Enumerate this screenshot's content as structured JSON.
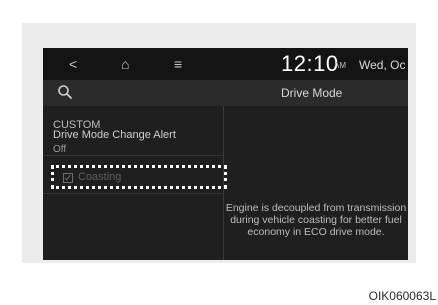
{
  "status_bar": {
    "back_icon": "<",
    "home_icon": "⌂",
    "menu_icon": "≡",
    "time": "12:10",
    "ampm": "AM",
    "date": "Wed, Oc"
  },
  "header": {
    "search_icon": "search-icon",
    "title": "Drive Mode"
  },
  "sidebar": {
    "section": "CUSTOM",
    "items": [
      {
        "label": "Drive Mode Change Alert",
        "value": "Off"
      },
      {
        "label": "Coasting",
        "checked": false
      }
    ]
  },
  "description": "Engine is decoupled from transmission during vehicle coasting for better fuel economy in ECO drive mode.",
  "caption": "OIK060063L",
  "colors": {
    "screen_bg": "#1f1f1f",
    "highlight_border": "#ffffff"
  }
}
